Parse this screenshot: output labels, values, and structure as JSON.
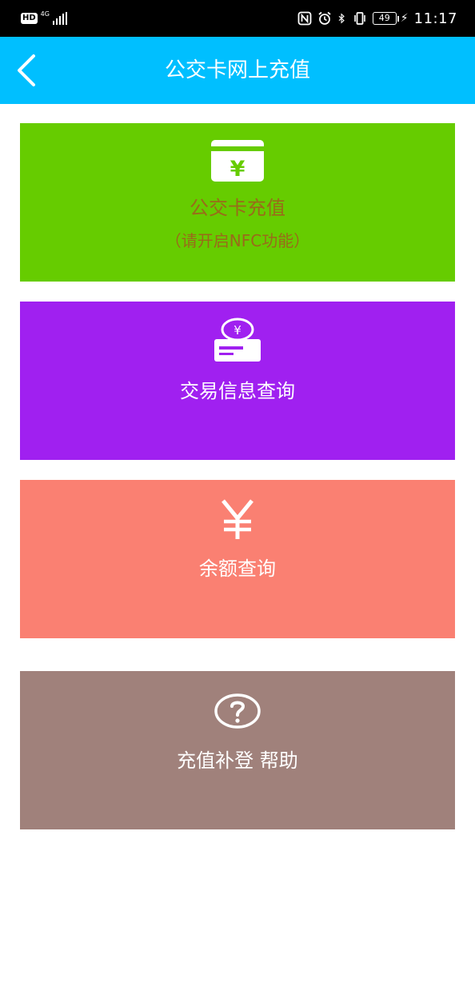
{
  "status_bar": {
    "hd_badge": "HD",
    "network_type": "4G",
    "battery_level": "49",
    "time": "11:17"
  },
  "header": {
    "title": "公交卡网上充值",
    "background_color": "#00bfff"
  },
  "menu": {
    "topup": {
      "label": "公交卡充值",
      "note": "（请开启NFC功能）",
      "icon": "yen-card-icon",
      "color": "#66cc00",
      "text_color": "#9a6a1a"
    },
    "transactions": {
      "label": "交易信息查询",
      "icon": "yen-receipt-icon",
      "color": "#a020f0"
    },
    "balance": {
      "label": "余额查询",
      "icon": "yen-icon",
      "color": "#fa8072"
    },
    "help": {
      "label": "充值补登 帮助",
      "icon": "question-icon",
      "color": "#a0817b"
    }
  }
}
